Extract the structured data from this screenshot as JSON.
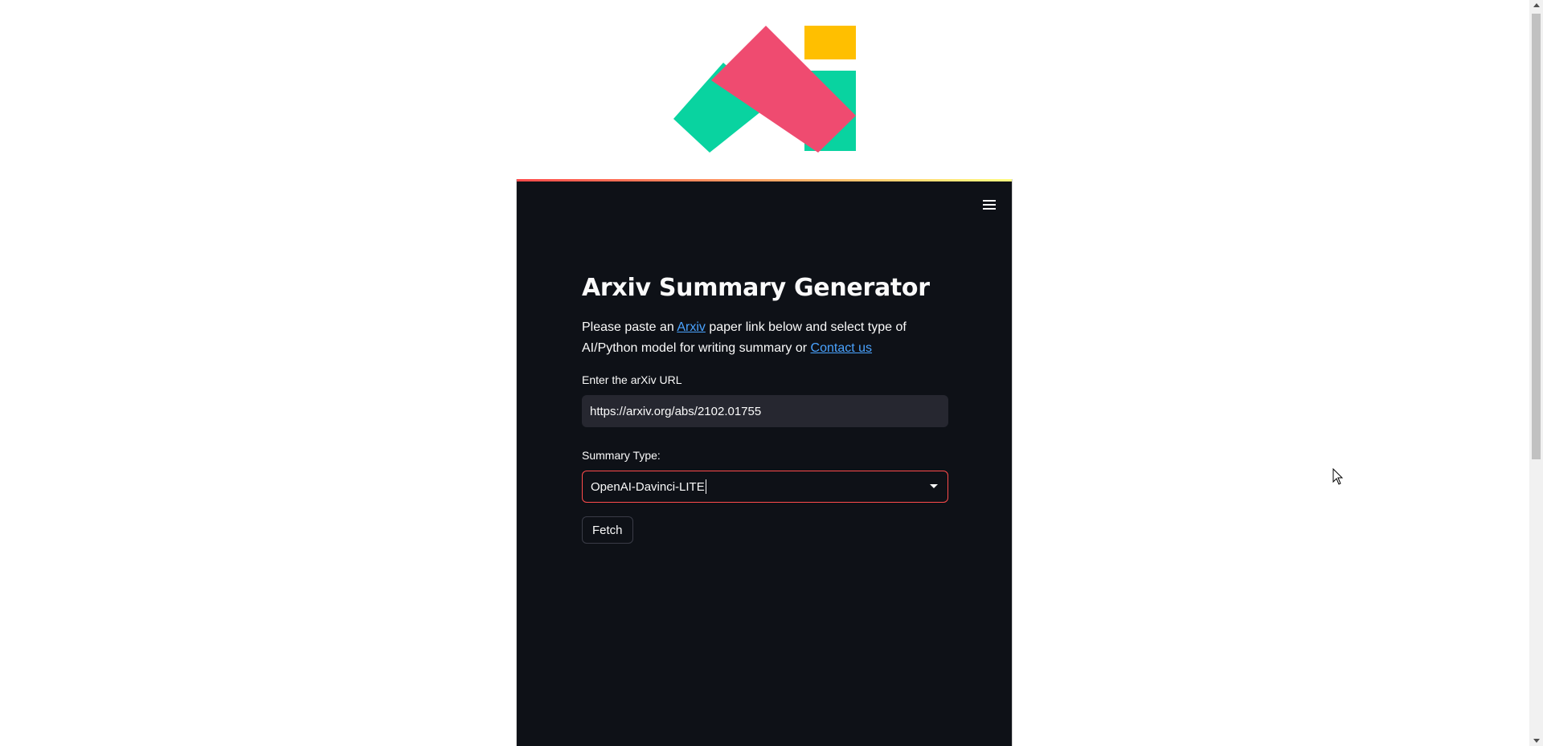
{
  "app": {
    "title": "Arxiv Summary Generator",
    "intro": {
      "prefix": "Please paste an ",
      "arxiv_link": "Arxiv",
      "middle": " paper link below and select type of AI/Python model for writing summary or ",
      "contact_link": "Contact us"
    },
    "url_field": {
      "label": "Enter the arXiv URL",
      "value": "https://arxiv.org/abs/2102.01755"
    },
    "summary_type": {
      "label": "Summary Type:",
      "selected": "OpenAI-Davinci-LITE"
    },
    "fetch_button": "Fetch"
  },
  "icons": {
    "menu": "hamburger-menu-icon",
    "logo": "brand-logo",
    "dropdown": "chevron-down-icon",
    "cursor": "mouse-pointer-icon"
  },
  "colors": {
    "app_background": "#0e1117",
    "input_background": "#262730",
    "accent": "#ff4b4b",
    "link": "#4aa3ff",
    "logo_green": "#09d3a0",
    "logo_pink": "#ef4b70",
    "logo_yellow": "#ffbf00"
  }
}
